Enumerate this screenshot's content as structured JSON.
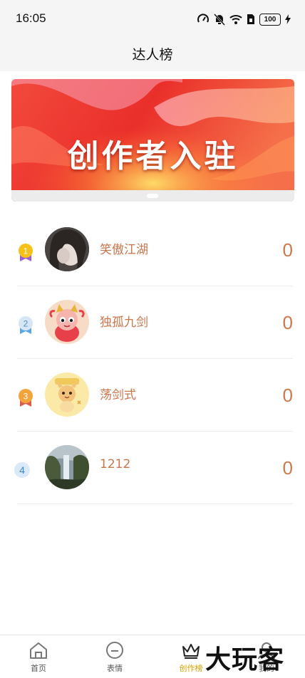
{
  "status_bar": {
    "time": "16:05",
    "battery": "100"
  },
  "header": {
    "title": "达人榜"
  },
  "banner": {
    "text": "创作者入驻"
  },
  "ranking": [
    {
      "rank": "1",
      "name": "笑傲江湖",
      "score": "0"
    },
    {
      "rank": "2",
      "name": "独孤九剑",
      "score": "0"
    },
    {
      "rank": "3",
      "name": "荡剑式",
      "score": "0"
    },
    {
      "rank": "4",
      "name": "1212",
      "score": "0"
    }
  ],
  "tabs": [
    {
      "label": "首页",
      "icon": "home-icon"
    },
    {
      "label": "表情",
      "icon": "emoji-icon"
    },
    {
      "label": "创作榜",
      "icon": "crown-icon",
      "active": true
    },
    {
      "label": "我的",
      "icon": "profile-icon"
    }
  ],
  "watermark": "大玩客",
  "colors": {
    "accent": "#d8a200",
    "name_text": "#c9764d",
    "banner_red": "#e8302a"
  }
}
